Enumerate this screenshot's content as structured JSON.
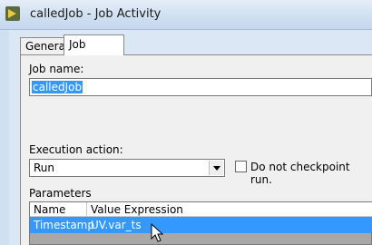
{
  "window": {
    "title": "calledJob - Job Activity"
  },
  "tabs": [
    {
      "label": "General"
    },
    {
      "label": "Job"
    }
  ],
  "job": {
    "name_label": "Job name:",
    "name_value": "calledJob",
    "execution_label": "Execution action:",
    "execution_value": "Run",
    "checkpoint_label": "Do not checkpoint run."
  },
  "parameters": {
    "label": "Parameters",
    "columns": [
      "Name",
      "Value Expression"
    ],
    "rows": [
      {
        "name": "Timestamp",
        "value": "UV.var_ts"
      }
    ]
  }
}
